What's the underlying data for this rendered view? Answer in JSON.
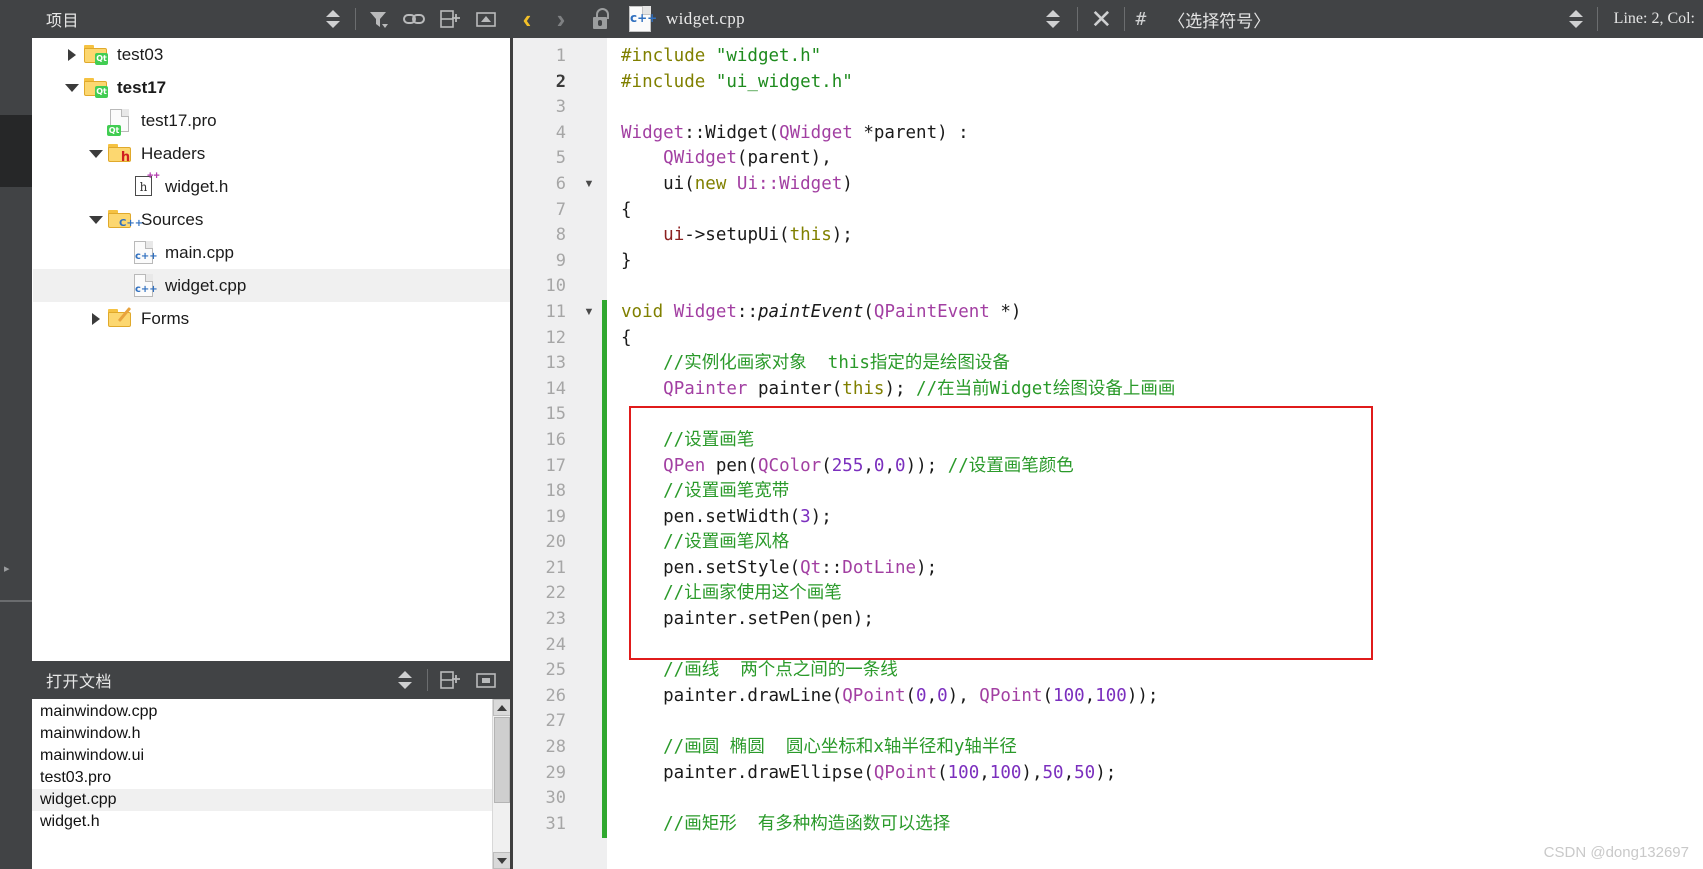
{
  "project_panel": {
    "title": "项目",
    "tools": [
      {
        "name": "updown-selector",
        "glyph": "updown"
      },
      {
        "name": "filter-icon",
        "glyph": "filter"
      },
      {
        "name": "link-icon",
        "glyph": "link"
      },
      {
        "name": "split-add-icon",
        "glyph": "split-add"
      },
      {
        "name": "close-split-icon",
        "glyph": "close-split"
      }
    ],
    "tree": [
      {
        "label": "test03",
        "indent": 0,
        "arrow": "closed",
        "icon": "qt-folder",
        "bold": false,
        "selected": false
      },
      {
        "label": "test17",
        "indent": 0,
        "arrow": "open",
        "icon": "qt-folder",
        "bold": true,
        "selected": false
      },
      {
        "label": "test17.pro",
        "indent": 1,
        "arrow": "none",
        "icon": "qt-file",
        "bold": false,
        "selected": false
      },
      {
        "label": "Headers",
        "indent": 1,
        "arrow": "open",
        "icon": "h-folder",
        "bold": false,
        "selected": false
      },
      {
        "label": "widget.h",
        "indent": 2,
        "arrow": "none",
        "icon": "hpp-file",
        "bold": false,
        "selected": false
      },
      {
        "label": "Sources",
        "indent": 1,
        "arrow": "open",
        "icon": "cpp-folder",
        "bold": false,
        "selected": false
      },
      {
        "label": "main.cpp",
        "indent": 2,
        "arrow": "none",
        "icon": "cpp-file",
        "bold": false,
        "selected": false
      },
      {
        "label": "widget.cpp",
        "indent": 2,
        "arrow": "none",
        "icon": "cpp-file",
        "bold": false,
        "selected": true
      },
      {
        "label": "Forms",
        "indent": 1,
        "arrow": "closed",
        "icon": "forms-folder",
        "bold": false,
        "selected": false
      }
    ]
  },
  "open_documents": {
    "title": "打开文档",
    "items": [
      {
        "label": "mainwindow.cpp",
        "selected": false
      },
      {
        "label": "mainwindow.h",
        "selected": false
      },
      {
        "label": "mainwindow.ui",
        "selected": false
      },
      {
        "label": "test03.pro",
        "selected": false
      },
      {
        "label": "widget.cpp",
        "selected": true
      },
      {
        "label": "widget.h",
        "selected": false
      }
    ]
  },
  "editor_toolbar": {
    "back_label": "‹",
    "forward_label": "›",
    "file_name": "widget.cpp",
    "close_label": "✕",
    "hash_label": "#",
    "symbol_selector": "〈选择符号〉",
    "line_col": "Line: 2, Col:"
  },
  "editor": {
    "current_line": 2,
    "fold_markers": [
      6,
      11
    ],
    "changebar_lines": [
      11,
      12,
      13,
      14,
      15,
      16,
      17,
      18,
      19,
      20,
      21,
      22,
      23,
      24,
      25,
      26,
      27,
      28,
      29,
      30,
      31
    ],
    "lines": [
      {
        "n": 1,
        "tokens": [
          {
            "t": "#include ",
            "c": "k-pre"
          },
          {
            "t": "\"widget.h\"",
            "c": "k-str"
          }
        ]
      },
      {
        "n": 2,
        "tokens": [
          {
            "t": "#include ",
            "c": "k-pre"
          },
          {
            "t": "\"ui_widget.h\"",
            "c": "k-str"
          }
        ]
      },
      {
        "n": 3,
        "tokens": []
      },
      {
        "n": 4,
        "tokens": [
          {
            "t": "Widget",
            "c": "k-cls"
          },
          {
            "t": "::",
            "c": "k-pln"
          },
          {
            "t": "Widget",
            "c": "k-fn"
          },
          {
            "t": "(",
            "c": "k-pln"
          },
          {
            "t": "QWidget",
            "c": "k-cls"
          },
          {
            "t": " *parent) :",
            "c": "k-pln"
          }
        ]
      },
      {
        "n": 5,
        "tokens": [
          {
            "t": "    ",
            "c": "k-pln"
          },
          {
            "t": "QWidget",
            "c": "k-cls"
          },
          {
            "t": "(parent),",
            "c": "k-pln"
          }
        ]
      },
      {
        "n": 6,
        "tokens": [
          {
            "t": "    ui(",
            "c": "k-pln"
          },
          {
            "t": "new",
            "c": "k-kw"
          },
          {
            "t": " ",
            "c": "k-pln"
          },
          {
            "t": "Ui::Widget",
            "c": "k-cls"
          },
          {
            "t": ")",
            "c": "k-pln"
          }
        ]
      },
      {
        "n": 7,
        "tokens": [
          {
            "t": "{",
            "c": "k-pln"
          }
        ]
      },
      {
        "n": 8,
        "tokens": [
          {
            "t": "    ",
            "c": "k-pln"
          },
          {
            "t": "ui",
            "c": "k-var"
          },
          {
            "t": "->setupUi(",
            "c": "k-pln"
          },
          {
            "t": "this",
            "c": "k-kw"
          },
          {
            "t": ");",
            "c": "k-pln"
          }
        ]
      },
      {
        "n": 9,
        "tokens": [
          {
            "t": "}",
            "c": "k-pln"
          }
        ]
      },
      {
        "n": 10,
        "tokens": []
      },
      {
        "n": 11,
        "tokens": [
          {
            "t": "void",
            "c": "k-kw"
          },
          {
            "t": " ",
            "c": "k-pln"
          },
          {
            "t": "Widget",
            "c": "k-cls"
          },
          {
            "t": "::",
            "c": "k-pln"
          },
          {
            "t": "paintEvent",
            "c": "k-fni"
          },
          {
            "t": "(",
            "c": "k-pln"
          },
          {
            "t": "QPaintEvent",
            "c": "k-cls"
          },
          {
            "t": " *)",
            "c": "k-pln"
          }
        ]
      },
      {
        "n": 12,
        "tokens": [
          {
            "t": "{",
            "c": "k-pln"
          }
        ]
      },
      {
        "n": 13,
        "tokens": [
          {
            "t": "    //实例化画家对象  this指定的是绘图设备",
            "c": "k-cmt"
          }
        ]
      },
      {
        "n": 14,
        "tokens": [
          {
            "t": "    ",
            "c": "k-pln"
          },
          {
            "t": "QPainter",
            "c": "k-cls"
          },
          {
            "t": " painter(",
            "c": "k-pln"
          },
          {
            "t": "this",
            "c": "k-kw"
          },
          {
            "t": "); ",
            "c": "k-pln"
          },
          {
            "t": "//在当前Widget绘图设备上画画",
            "c": "k-cmt"
          }
        ]
      },
      {
        "n": 15,
        "tokens": []
      },
      {
        "n": 16,
        "tokens": [
          {
            "t": "    //设置画笔",
            "c": "k-cmt"
          }
        ]
      },
      {
        "n": 17,
        "tokens": [
          {
            "t": "    ",
            "c": "k-pln"
          },
          {
            "t": "QPen",
            "c": "k-cls"
          },
          {
            "t": " pen(",
            "c": "k-pln"
          },
          {
            "t": "QColor",
            "c": "k-cls"
          },
          {
            "t": "(",
            "c": "k-pln"
          },
          {
            "t": "255",
            "c": "k-num"
          },
          {
            "t": ",",
            "c": "k-pln"
          },
          {
            "t": "0",
            "c": "k-num"
          },
          {
            "t": ",",
            "c": "k-pln"
          },
          {
            "t": "0",
            "c": "k-num"
          },
          {
            "t": ")); ",
            "c": "k-pln"
          },
          {
            "t": "//设置画笔颜色",
            "c": "k-cmt"
          }
        ]
      },
      {
        "n": 18,
        "tokens": [
          {
            "t": "    //设置画笔宽带",
            "c": "k-cmt"
          }
        ]
      },
      {
        "n": 19,
        "tokens": [
          {
            "t": "    pen.setWidth(",
            "c": "k-pln"
          },
          {
            "t": "3",
            "c": "k-num"
          },
          {
            "t": ");",
            "c": "k-pln"
          }
        ]
      },
      {
        "n": 20,
        "tokens": [
          {
            "t": "    //设置画笔风格",
            "c": "k-cmt"
          }
        ]
      },
      {
        "n": 21,
        "tokens": [
          {
            "t": "    pen.setStyle(",
            "c": "k-pln"
          },
          {
            "t": "Qt",
            "c": "k-cls"
          },
          {
            "t": "::",
            "c": "k-pln"
          },
          {
            "t": "DotLine",
            "c": "k-cls"
          },
          {
            "t": ");",
            "c": "k-pln"
          }
        ]
      },
      {
        "n": 22,
        "tokens": [
          {
            "t": "    //让画家使用这个画笔",
            "c": "k-cmt"
          }
        ]
      },
      {
        "n": 23,
        "tokens": [
          {
            "t": "    painter.setPen(pen);",
            "c": "k-pln"
          }
        ]
      },
      {
        "n": 24,
        "tokens": []
      },
      {
        "n": 25,
        "tokens": [
          {
            "t": "    //画线  两个点之间的一条线",
            "c": "k-cmt"
          }
        ]
      },
      {
        "n": 26,
        "tokens": [
          {
            "t": "    painter.drawLine(",
            "c": "k-pln"
          },
          {
            "t": "QPoint",
            "c": "k-cls"
          },
          {
            "t": "(",
            "c": "k-pln"
          },
          {
            "t": "0",
            "c": "k-num"
          },
          {
            "t": ",",
            "c": "k-pln"
          },
          {
            "t": "0",
            "c": "k-num"
          },
          {
            "t": "), ",
            "c": "k-pln"
          },
          {
            "t": "QPoint",
            "c": "k-cls"
          },
          {
            "t": "(",
            "c": "k-pln"
          },
          {
            "t": "100",
            "c": "k-num"
          },
          {
            "t": ",",
            "c": "k-pln"
          },
          {
            "t": "100",
            "c": "k-num"
          },
          {
            "t": "));",
            "c": "k-pln"
          }
        ]
      },
      {
        "n": 27,
        "tokens": []
      },
      {
        "n": 28,
        "tokens": [
          {
            "t": "    //画圆 椭圆  圆心坐标和x轴半径和y轴半径",
            "c": "k-cmt"
          }
        ]
      },
      {
        "n": 29,
        "tokens": [
          {
            "t": "    painter.drawEllipse(",
            "c": "k-pln"
          },
          {
            "t": "QPoint",
            "c": "k-cls"
          },
          {
            "t": "(",
            "c": "k-pln"
          },
          {
            "t": "100",
            "c": "k-num"
          },
          {
            "t": ",",
            "c": "k-pln"
          },
          {
            "t": "100",
            "c": "k-num"
          },
          {
            "t": "),",
            "c": "k-pln"
          },
          {
            "t": "50",
            "c": "k-num"
          },
          {
            "t": ",",
            "c": "k-pln"
          },
          {
            "t": "50",
            "c": "k-num"
          },
          {
            "t": ");",
            "c": "k-pln"
          }
        ]
      },
      {
        "n": 30,
        "tokens": []
      },
      {
        "n": 31,
        "tokens": [
          {
            "t": "    //画矩形  有多种构造函数可以选择",
            "c": "k-cmt"
          }
        ]
      }
    ],
    "highlight_box": {
      "from_line": 15,
      "to_line": 24,
      "color": "#e01b1b"
    }
  },
  "watermark": "CSDN @dong132697",
  "colors": {
    "toolbar_bg": "#414345",
    "gutter_bg": "#efeff0",
    "selection_bg": "#f0f0f0",
    "accent_yellow": "#f3c028",
    "changebar_green": "#2fa82f",
    "highlight_red": "#e01b1b"
  }
}
